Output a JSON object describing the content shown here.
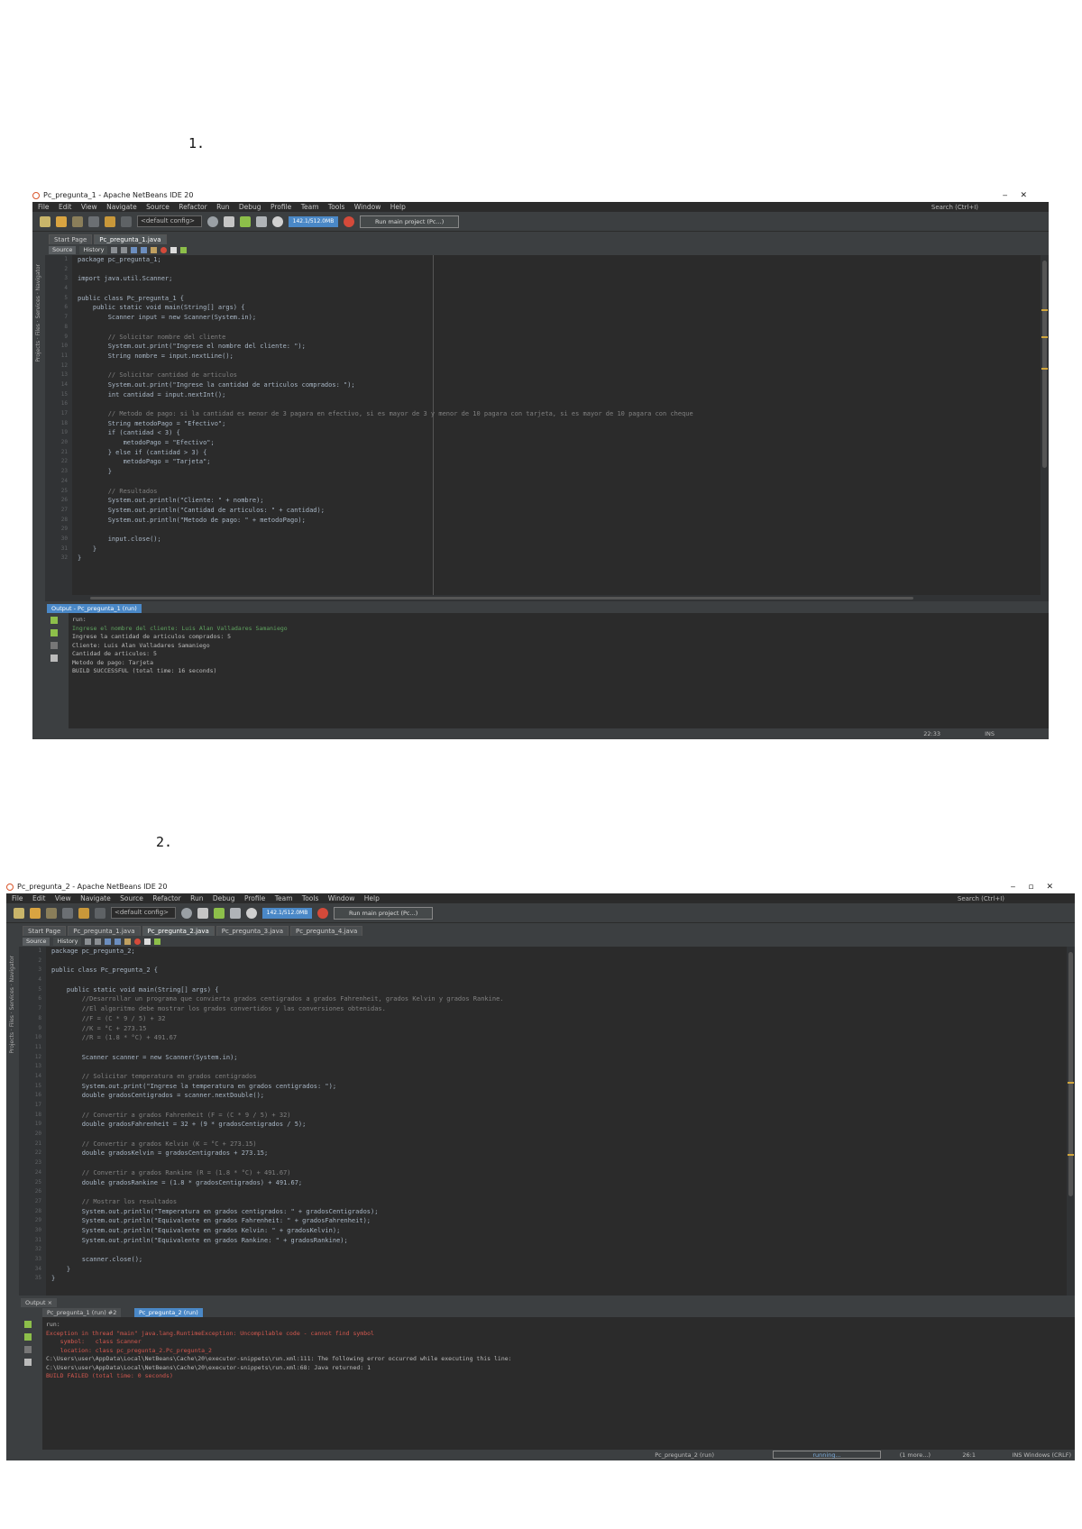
{
  "labels": {
    "first": "1.",
    "second": "2."
  },
  "shot1": {
    "title": "Pc_pregunta_1 - Apache NetBeans IDE 20",
    "menu": [
      "File",
      "Edit",
      "View",
      "Navigate",
      "Source",
      "Refactor",
      "Run",
      "Debug",
      "Profile",
      "Team",
      "Tools",
      "Window",
      "Help"
    ],
    "search_placeholder": "Search (Ctrl+I)",
    "config": "<default config>",
    "memory": "142.1/512.0MB",
    "profiler": "Run main project (Pc...)",
    "tabs": [
      "Start Page",
      "Pc_pregunta_1.java"
    ],
    "editor_tabs": {
      "source": "Source",
      "history": "History"
    },
    "code": [
      {
        "t": "package pc_pregunta_1;",
        "c": ""
      },
      {
        "t": "",
        "c": ""
      },
      {
        "t": "import java.util.Scanner;",
        "c": ""
      },
      {
        "t": "",
        "c": ""
      },
      {
        "t": "public class Pc_pregunta_1 {",
        "c": ""
      },
      {
        "t": "    public static void main(String[] args) {",
        "c": ""
      },
      {
        "t": "        Scanner input = new Scanner(System.in);",
        "c": ""
      },
      {
        "t": "",
        "c": ""
      },
      {
        "t": "        // Solicitar nombre del cliente",
        "c": "cmt"
      },
      {
        "t": "        System.out.print(\"Ingrese el nombre del cliente: \");",
        "c": ""
      },
      {
        "t": "        String nombre = input.nextLine();",
        "c": ""
      },
      {
        "t": "",
        "c": ""
      },
      {
        "t": "        // Solicitar cantidad de articulos",
        "c": "cmt"
      },
      {
        "t": "        System.out.print(\"Ingrese la cantidad de articulos comprados: \");",
        "c": ""
      },
      {
        "t": "        int cantidad = input.nextInt();",
        "c": ""
      },
      {
        "t": "",
        "c": ""
      },
      {
        "t": "        // Metodo de pago: si la cantidad es menor de 3 pagara en efectivo, si es mayor de 3 y menor de 10 pagara con tarjeta, si es mayor de 10 pagara con cheque",
        "c": "cmt"
      },
      {
        "t": "        String metodoPago = \"Efectivo\";",
        "c": ""
      },
      {
        "t": "        if (cantidad < 3) {",
        "c": ""
      },
      {
        "t": "            metodoPago = \"Efectivo\";",
        "c": ""
      },
      {
        "t": "        } else if (cantidad > 3) {",
        "c": ""
      },
      {
        "t": "            metodoPago = \"Tarjeta\";",
        "c": ""
      },
      {
        "t": "        }",
        "c": ""
      },
      {
        "t": "",
        "c": ""
      },
      {
        "t": "        // Resultados",
        "c": "cmt"
      },
      {
        "t": "        System.out.println(\"Cliente: \" + nombre);",
        "c": ""
      },
      {
        "t": "        System.out.println(\"Cantidad de articulos: \" + cantidad);",
        "c": ""
      },
      {
        "t": "        System.out.println(\"Metodo de pago: \" + metodoPago);",
        "c": ""
      },
      {
        "t": "",
        "c": ""
      },
      {
        "t": "        input.close();",
        "c": ""
      },
      {
        "t": "    }",
        "c": ""
      },
      {
        "t": "}",
        "c": ""
      }
    ],
    "output_tab": "Output - Pc_pregunta_1 (run)",
    "output": [
      {
        "t": "run:",
        "c": ""
      },
      {
        "t": "Ingrese el nombre del cliente: Luis Alan Valladares Samaniego",
        "c": "in"
      },
      {
        "t": "Ingrese la cantidad de articulos comprados: 5",
        "c": ""
      },
      {
        "t": "Cliente: Luis Alan Valladares Samaniego",
        "c": ""
      },
      {
        "t": "Cantidad de articulos: 5",
        "c": ""
      },
      {
        "t": "Metodo de pago: Tarjeta",
        "c": ""
      },
      {
        "t": "BUILD SUCCESSFUL (total time: 16 seconds)",
        "c": ""
      }
    ],
    "status_pos": "22:33",
    "status_ins": "INS"
  },
  "shot2": {
    "title": "Pc_pregunta_2 - Apache NetBeans IDE 20",
    "menu": [
      "File",
      "Edit",
      "View",
      "Navigate",
      "Source",
      "Refactor",
      "Run",
      "Debug",
      "Profile",
      "Team",
      "Tools",
      "Window",
      "Help"
    ],
    "search_placeholder": "Search (Ctrl+I)",
    "config": "<default config>",
    "memory": "142.1/512.0MB",
    "profiler": "Run main project (Pc...)",
    "tabs": [
      "Start Page",
      "Pc_pregunta_1.java",
      "Pc_pregunta_2.java",
      "Pc_pregunta_3.java",
      "Pc_pregunta_4.java"
    ],
    "editor_tabs": {
      "source": "Source",
      "history": "History"
    },
    "code": [
      {
        "t": "package pc_pregunta_2;",
        "c": ""
      },
      {
        "t": "",
        "c": ""
      },
      {
        "t": "public class Pc_pregunta_2 {",
        "c": ""
      },
      {
        "t": "",
        "c": ""
      },
      {
        "t": "    public static void main(String[] args) {",
        "c": ""
      },
      {
        "t": "        //Desarrollar un programa que convierta grados centigrados a grados Fahrenheit, grados Kelvin y grados Rankine.",
        "c": "cmt"
      },
      {
        "t": "        //El algoritmo debe mostrar los grados convertidos y las conversiones obtenidas.",
        "c": "cmt"
      },
      {
        "t": "        //F = (C * 9 / 5) + 32",
        "c": "cmt"
      },
      {
        "t": "        //K = °C + 273.15",
        "c": "cmt"
      },
      {
        "t": "        //R = (1.8 * °C) + 491.67",
        "c": "cmt"
      },
      {
        "t": "",
        "c": ""
      },
      {
        "t": "        Scanner scanner = new Scanner(System.in);",
        "c": ""
      },
      {
        "t": "",
        "c": ""
      },
      {
        "t": "        // Solicitar temperatura en grados centigrados",
        "c": "cmt"
      },
      {
        "t": "        System.out.print(\"Ingrese la temperatura en grados centigrados: \");",
        "c": ""
      },
      {
        "t": "        double gradosCentigrados = scanner.nextDouble();",
        "c": ""
      },
      {
        "t": "",
        "c": ""
      },
      {
        "t": "        // Convertir a grados Fahrenheit (F = (C * 9 / 5) + 32)",
        "c": "cmt"
      },
      {
        "t": "        double gradosFahrenheit = 32 + (9 * gradosCentigrados / 5);",
        "c": ""
      },
      {
        "t": "",
        "c": ""
      },
      {
        "t": "        // Convertir a grados Kelvin (K = °C + 273.15)",
        "c": "cmt"
      },
      {
        "t": "        double gradosKelvin = gradosCentigrados + 273.15;",
        "c": ""
      },
      {
        "t": "",
        "c": ""
      },
      {
        "t": "        // Convertir a grados Rankine (R = (1.8 * °C) + 491.67)",
        "c": "cmt"
      },
      {
        "t": "        double gradosRankine = (1.8 * gradosCentigrados) + 491.67;",
        "c": ""
      },
      {
        "t": "",
        "c": ""
      },
      {
        "t": "        // Mostrar los resultados",
        "c": "cmt"
      },
      {
        "t": "        System.out.println(\"Temperatura en grados centigrados: \" + gradosCentigrados);",
        "c": ""
      },
      {
        "t": "        System.out.println(\"Equivalente en grados Fahrenheit: \" + gradosFahrenheit);",
        "c": ""
      },
      {
        "t": "        System.out.println(\"Equivalente en grados Kelvin: \" + gradosKelvin);",
        "c": ""
      },
      {
        "t": "        System.out.println(\"Equivalente en grados Rankine: \" + gradosRankine);",
        "c": ""
      },
      {
        "t": "",
        "c": ""
      },
      {
        "t": "        scanner.close();",
        "c": ""
      },
      {
        "t": "    }",
        "c": ""
      },
      {
        "t": "}",
        "c": ""
      }
    ],
    "output_header": "Output ×",
    "output_tab_a": "Pc_pregunta_1 (run) #2",
    "output_tab_b": "Pc_pregunta_2 (run)",
    "output": [
      {
        "t": "run:",
        "c": ""
      },
      {
        "t": "Exception in thread \"main\" java.lang.RuntimeException: Uncompilable code - cannot find symbol",
        "c": "err"
      },
      {
        "t": "    symbol:   class Scanner",
        "c": "err"
      },
      {
        "t": "    location: class pc_pregunta_2.Pc_pregunta_2",
        "c": "err"
      },
      {
        "t": "C:\\Users\\user\\AppData\\Local\\NetBeans\\Cache\\20\\executor-snippets\\run.xml:111: The following error occurred while executing this line:",
        "c": ""
      },
      {
        "t": "C:\\Users\\user\\AppData\\Local\\NetBeans\\Cache\\20\\executor-snippets\\run.xml:68: Java returned: 1",
        "c": ""
      },
      {
        "t": "BUILD FAILED (total time: 0 seconds)",
        "c": "err"
      }
    ],
    "status_project": "Pc_pregunta_2 (run)",
    "status_running": "running...",
    "status_errors": "(1 more...)",
    "status_pos": "26:1",
    "status_ins": "INS Windows (CRLF)"
  }
}
